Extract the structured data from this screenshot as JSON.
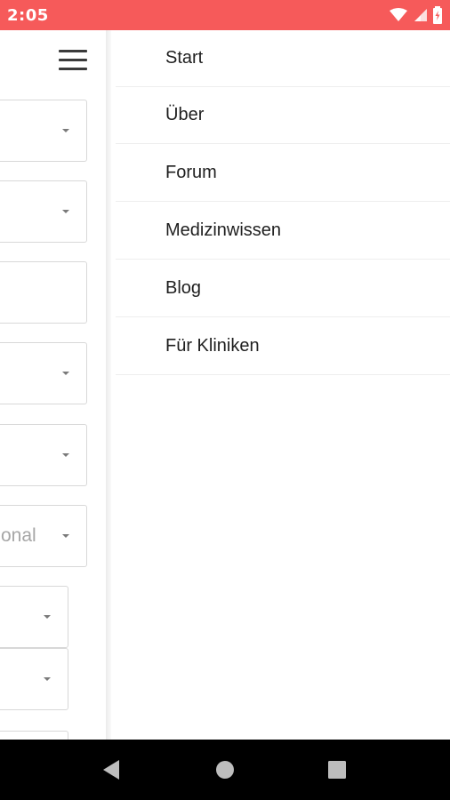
{
  "status_bar": {
    "time": "2:05",
    "background_color": "#f65a5a",
    "icons": [
      "wifi-icon",
      "cellular-signal-icon",
      "battery-icon"
    ]
  },
  "left_page": {
    "menu_icon": "hamburger-menu-icon",
    "fields": [
      {
        "type": "select",
        "value": ""
      },
      {
        "type": "select",
        "value": ""
      },
      {
        "type": "text",
        "value": ""
      },
      {
        "type": "select",
        "value": ""
      },
      {
        "type": "select",
        "value": ""
      },
      {
        "type": "select",
        "value": "onal"
      },
      {
        "type": "select",
        "value": ""
      },
      {
        "type": "select",
        "value": ""
      },
      {
        "type": "text",
        "value": ""
      }
    ]
  },
  "drawer": {
    "items": [
      {
        "label": "Start"
      },
      {
        "label": "Über"
      },
      {
        "label": "Forum"
      },
      {
        "label": "Medizinwissen"
      },
      {
        "label": "Blog"
      },
      {
        "label": "Für Kliniken"
      }
    ]
  },
  "nav_bar": {
    "buttons": [
      "back-icon",
      "home-icon",
      "recents-icon"
    ]
  }
}
